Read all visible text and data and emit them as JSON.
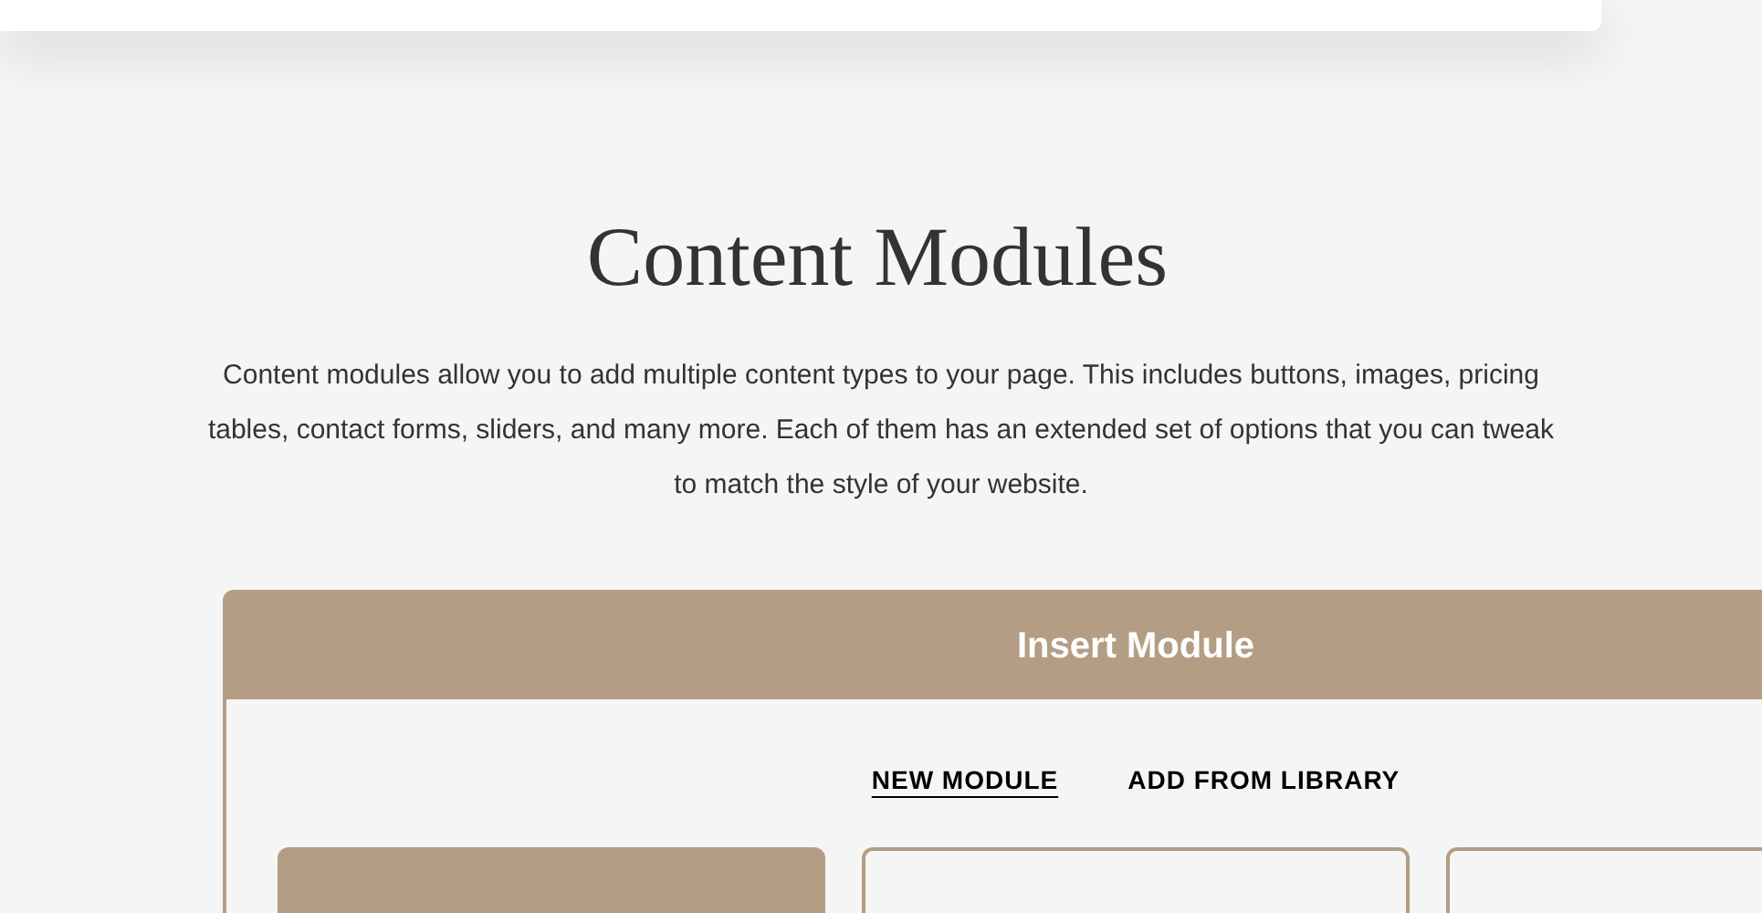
{
  "heading": "Content Modules",
  "description": "Content modules allow you to add multiple content types to your page. This includes buttons, images, pricing tables, contact forms, sliders, and many more. Each of them has an extended set of options that you can tweak to match the style of your website.",
  "panel": {
    "title": "Insert Module",
    "tabs": [
      {
        "label": "NEW MODULE",
        "selected": true
      },
      {
        "label": "ADD FROM LIBRARY",
        "selected": false
      }
    ],
    "cards": [
      {
        "selected": true
      },
      {
        "selected": false
      },
      {
        "selected": false
      }
    ]
  }
}
